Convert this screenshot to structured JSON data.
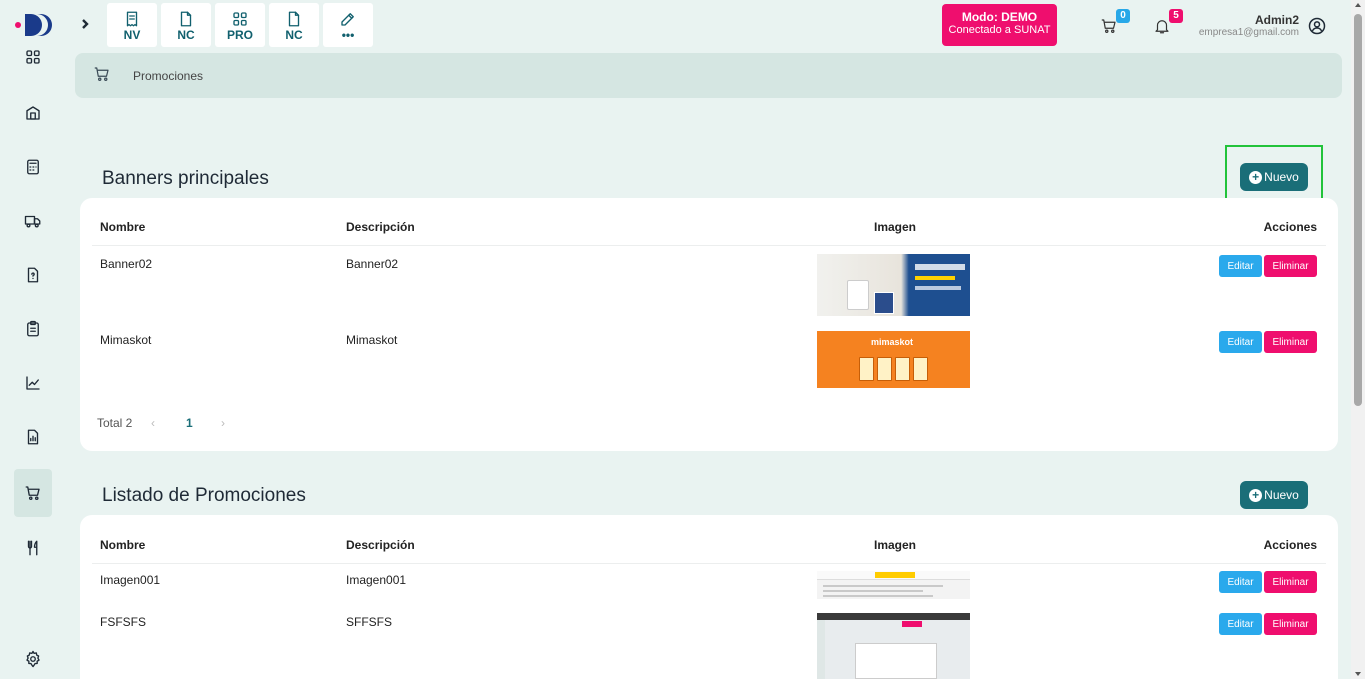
{
  "topbar": {
    "quick_actions": [
      {
        "label": "NV",
        "icon": "receipt-icon"
      },
      {
        "label": "NC",
        "icon": "document-icon"
      },
      {
        "label": "PRO",
        "icon": "grid-icon"
      },
      {
        "label": "NC",
        "icon": "document-icon"
      },
      {
        "label": "•••",
        "icon": "edit-icon"
      }
    ],
    "mode_title": "Modo: DEMO",
    "mode_subtitle": "Conectado a SUNAT",
    "cart_count": "0",
    "notifications_count": "5",
    "user_name": "Admin2",
    "user_email": "empresa1@gmail.com"
  },
  "breadcrumb": {
    "label": "Promociones"
  },
  "banners": {
    "title": "Banners principales",
    "new_label": "Nuevo",
    "columns": [
      "Nombre",
      "Descripción",
      "Imagen",
      "Acciones"
    ],
    "rows": [
      {
        "name": "Banner02",
        "description": "Banner02"
      },
      {
        "name": "Mimaskot",
        "description": "Mimaskot"
      }
    ],
    "image_text": "mimaskot",
    "edit_label": "Editar",
    "delete_label": "Eliminar",
    "total_label": "Total 2",
    "current_page": "1"
  },
  "promotions": {
    "title": "Listado de Promociones",
    "new_label": "Nuevo",
    "columns": [
      "Nombre",
      "Descripción",
      "Imagen",
      "Acciones"
    ],
    "rows": [
      {
        "name": "Imagen001",
        "description": "Imagen001"
      },
      {
        "name": "FSFSFS",
        "description": "SFFSFS"
      }
    ],
    "edit_label": "Editar",
    "delete_label": "Eliminar"
  },
  "colors": {
    "brand_teal": "#1a6e78",
    "demo_pink": "#ef0e6e",
    "edit_blue": "#2aa9ec",
    "highlight_green": "#22c33a"
  }
}
